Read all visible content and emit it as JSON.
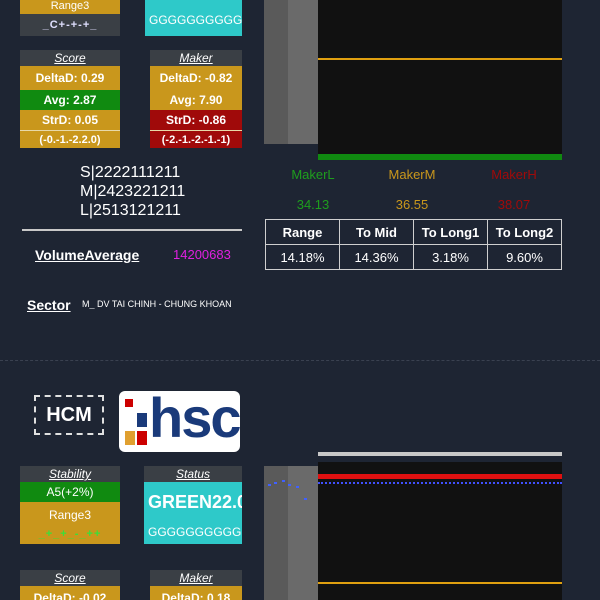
{
  "top": {
    "stability_card": {
      "range_label": "Range3",
      "trend": "_C+-+-+_"
    },
    "status_card": {
      "value": "GGGGGGGGGG"
    },
    "score": {
      "title": "Score",
      "delta": "DeltaD: 0.29",
      "avg": "Avg: 2.87",
      "str": "StrD: 0.05",
      "tuple": "(-0.-1.-2.2.0)"
    },
    "maker": {
      "title": "Maker",
      "delta": "DeltaD: -0.82",
      "avg": "Avg: 7.90",
      "str": "StrD: -0.86",
      "tuple": "(-2.-1.-2.-1.-1)"
    },
    "signals": [
      "S|2222111211",
      "M|2423221211",
      "L|2513121211"
    ],
    "volume": {
      "label": "VolumeAverage",
      "value": "14200683"
    },
    "sector": {
      "label": "Sector",
      "value": "M_ DV TAI CHINH - CHUNG KHOAN"
    },
    "makers": {
      "labels": [
        "MakerL",
        "MakerM",
        "MakerH"
      ],
      "values": [
        "34.13",
        "36.55",
        "38.07"
      ]
    },
    "stats_table": {
      "headers": [
        "Range",
        "To Mid",
        "To Long1",
        "To Long2"
      ],
      "values": [
        "14.18%",
        "14.36%",
        "3.18%",
        "9.60%"
      ]
    }
  },
  "bottom": {
    "exchange": "HCM",
    "logo_text": "hsc",
    "stability": {
      "title": "Stability",
      "value": "A5(+2%)",
      "range_label": "Range3",
      "trend": "_+_+_-_++"
    },
    "status": {
      "title": "Status",
      "value": "GREEN22.0",
      "sub": "GGGGGGGGGG"
    },
    "score": {
      "title": "Score",
      "delta": "DeltaD: -0.02"
    },
    "maker": {
      "title": "Maker",
      "delta": "DeltaD: 0.18"
    }
  },
  "colors": {
    "gold": "#c9971c",
    "green": "#108a10",
    "red": "#a00a0a",
    "teal": "#2ec9c9",
    "maker_low": "#1e9e1e",
    "maker_mid": "#c9971c",
    "maker_high": "#a00a0a",
    "volume_value": "#e020e0"
  }
}
